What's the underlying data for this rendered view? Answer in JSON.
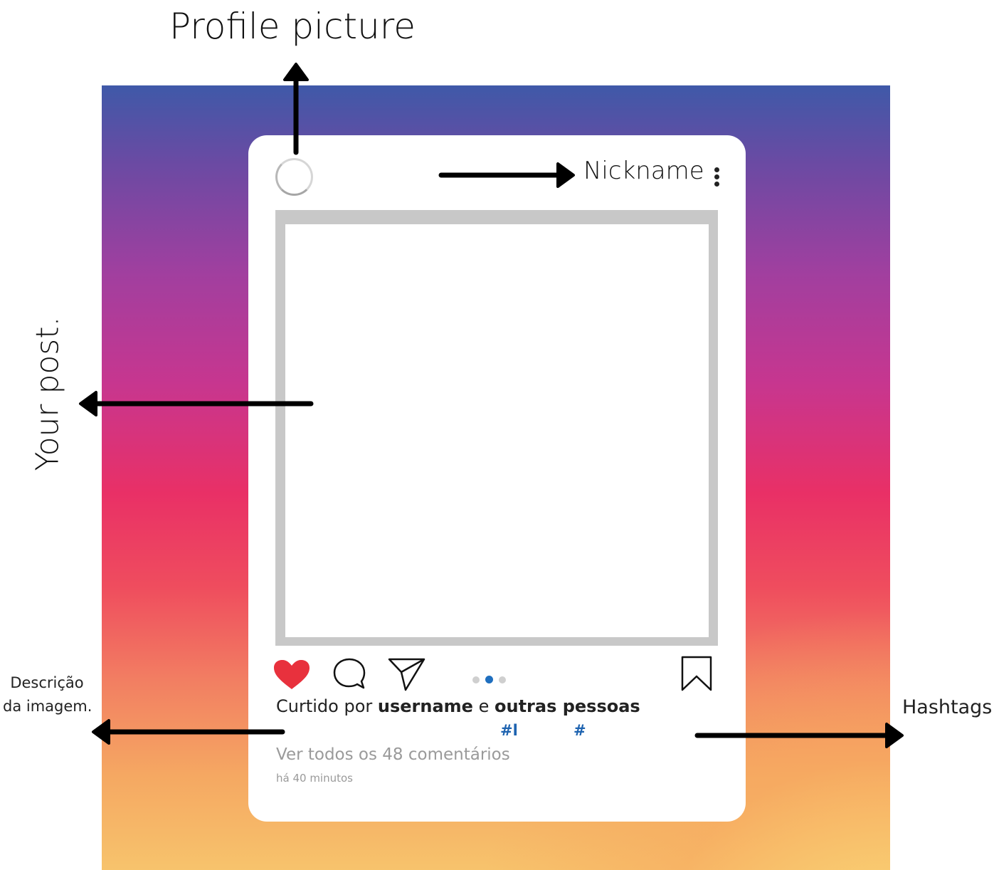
{
  "annotations": {
    "profile_picture": "Profile picture",
    "nickname": "Nickname",
    "your_post": "Your post.",
    "descricao_line1": "Descrição",
    "descricao_line2": "da imagem.",
    "hashtags": "Hashtags"
  },
  "post": {
    "liked_prefix": "Curtido por",
    "liked_user": "username",
    "liked_conj": "e",
    "liked_others": "outras pessoas",
    "hashtag_1": "#l",
    "hashtag_2": "#",
    "comments": "Ver todos os 48 comentários",
    "time": "há 40 minutos",
    "carousel_active_index": 1,
    "carousel_count": 3
  },
  "icons": {
    "like": "heart-icon",
    "comment": "comment-bubble-icon",
    "share": "paper-plane-icon",
    "save": "bookmark-icon",
    "menu": "kebab-menu-icon"
  },
  "colors": {
    "heart": "#e8313d",
    "hashtag": "#1e63b0",
    "carousel_active": "#1f6fbf",
    "frame_gray": "#c8c8c8"
  }
}
